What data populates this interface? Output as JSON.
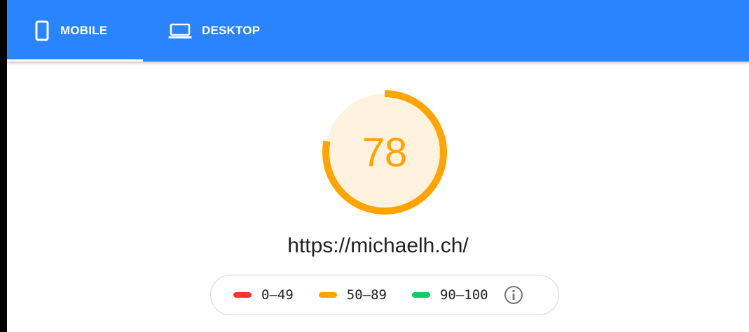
{
  "tabs": [
    {
      "label": "MOBILE",
      "icon": "smartphone-icon",
      "active": true
    },
    {
      "label": "DESKTOP",
      "icon": "laptop-icon",
      "active": false
    }
  ],
  "score": {
    "value": "78",
    "fraction": 0.78,
    "color": "#ffa400",
    "fill_color": "#fff3e0"
  },
  "url": "https://michaelh.ch/",
  "legend": [
    {
      "label": "0–49",
      "color": "#ff3333"
    },
    {
      "label": "50–89",
      "color": "#ffa400"
    },
    {
      "label": "90–100",
      "color": "#0cce6b"
    }
  ],
  "colors": {
    "header_bg": "#2a84ff",
    "header_text": "#ffffff"
  }
}
